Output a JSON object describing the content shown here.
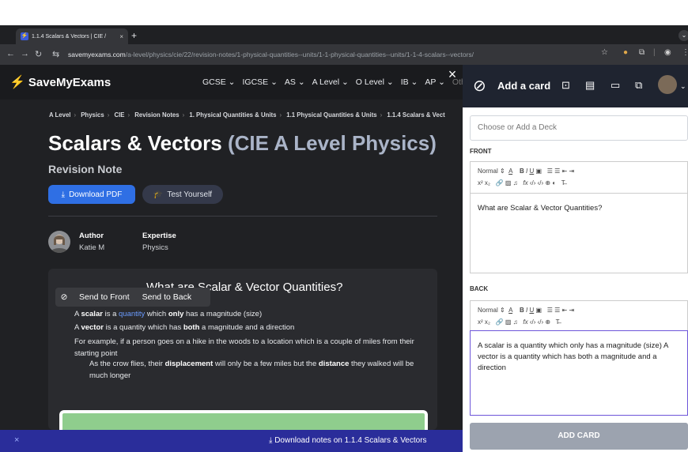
{
  "browser": {
    "tab_title": "1.1.4 Scalars & Vectors | CIE /",
    "tab_close": "×",
    "new_tab": "+",
    "url_domain": "savemyexams.com",
    "url_path": "/a-level/physics/cie/22/revision-notes/1-physical-quantities--units/1-1-physical-quantities--units/1-1-4-scalars--vectors/"
  },
  "site": {
    "logo": "SaveMyExams",
    "menu": [
      "GCSE",
      "IGCSE",
      "AS",
      "A Level",
      "O Level",
      "IB",
      "AP",
      "Oth"
    ]
  },
  "breadcrumbs": [
    "A Level",
    "Physics",
    "CIE",
    "Revision Notes",
    "1. Physical Quantities & Units",
    "1.1 Physical Quantities & Units",
    "1.1.4 Scalars & Vect"
  ],
  "page": {
    "title": "Scalars & Vectors",
    "title_suffix": "(CIE A Level Physics)",
    "revision_note": "Revision Note",
    "download_pdf": "Download PDF",
    "test_yourself": "Test Yourself",
    "author_label": "Author",
    "author_name": "Katie M",
    "expertise_label": "Expertise",
    "expertise_value": "Physics",
    "section_heading": "What are Scalar & Vector Quantities?"
  },
  "popover": {
    "send_front": "Send to Front",
    "send_back": "Send to Back"
  },
  "content": {
    "l1_a": "A ",
    "l1_b": "scalar",
    "l1_c": " is a ",
    "l1_d": "quantity",
    "l1_e": " which ",
    "l1_f": "only",
    "l1_g": " has a magnitude (size)",
    "l2_a": "A ",
    "l2_b": "vector",
    "l2_c": " is a quantity which has ",
    "l2_d": "both",
    "l2_e": " a magnitude and a direction",
    "l3": "For example, if a person goes on a hike in the woods to a location which is a couple of miles from their starting point",
    "l4_a": "As the crow flies, their ",
    "l4_b": "displacement",
    "l4_c": " will only be a few miles but the ",
    "l4_d": "distance",
    "l4_e": " they walked will be much longer"
  },
  "bottom_bar": {
    "close": "×",
    "download_text": "Download notes on 1.1.4 Scalars & Vectors"
  },
  "panel": {
    "title": "Add a card",
    "deck_placeholder": "Choose or Add a Deck",
    "front_label": "FRONT",
    "back_label": "BACK",
    "toolbar_normal": "Normal",
    "front_text": "What are Scalar & Vector Quantities?",
    "back_text": "A scalar is a quantity which only has a magnitude (size) A vector is a quantity which has both a magnitude and a direction",
    "add_button": "ADD CARD",
    "close_overlay": "×"
  }
}
